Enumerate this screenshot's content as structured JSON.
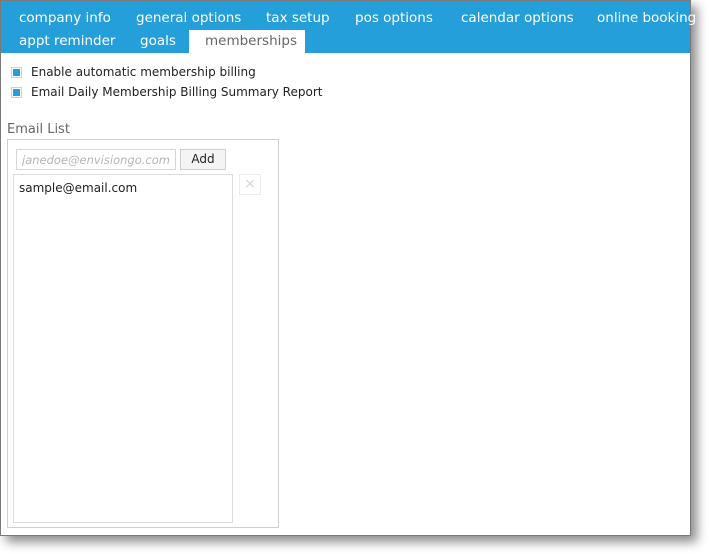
{
  "tabs": {
    "row1": [
      {
        "label": "company info"
      },
      {
        "label": "general options"
      },
      {
        "label": "tax setup"
      },
      {
        "label": "pos options"
      },
      {
        "label": "calendar options"
      },
      {
        "label": "online booking"
      }
    ],
    "row2": [
      {
        "label": "appt reminder"
      },
      {
        "label": "goals"
      },
      {
        "label": "memberships",
        "active": true
      }
    ]
  },
  "options": {
    "auto_billing": {
      "label": "Enable automatic membership billing",
      "checked": true
    },
    "daily_report": {
      "label": "Email Daily Membership Billing Summary Report",
      "checked": true
    }
  },
  "email_list": {
    "title": "Email List",
    "input_value": "",
    "input_placeholder": "janedoe@envisiongo.com...",
    "add_label": "Add",
    "delete_icon": "×",
    "items": [
      "sample@email.com"
    ]
  },
  "colors": {
    "accent": "#259fd9"
  }
}
